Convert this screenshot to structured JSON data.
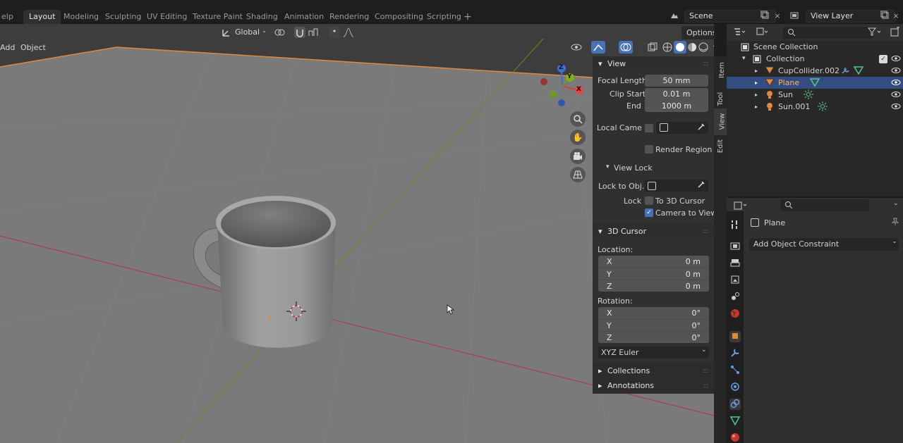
{
  "topbar": {
    "menu_fragment": "elp",
    "tabs": [
      "Layout",
      "Modeling",
      "Sculpting",
      "UV Editing",
      "Texture Paint",
      "Shading",
      "Animation",
      "Rendering",
      "Compositing",
      "Scripting"
    ],
    "active_tab": "Layout",
    "add_workspace": "+",
    "scene_name": "Scene",
    "view_layer": "View Layer"
  },
  "viewport_header": {
    "add": "Add",
    "object": "Object",
    "orientation": "Global",
    "options": "Options"
  },
  "gizmo": {
    "x": "X",
    "y": "Y",
    "z": "Z"
  },
  "sidebar_tabs": [
    "Item",
    "Tool",
    "View",
    "Edit"
  ],
  "sidebar_active_tab": "View",
  "view_panel": {
    "title": "View",
    "focal_length_label": "Focal Length",
    "focal_length_value": "50 mm",
    "clip_start_label": "Clip Start",
    "clip_start_value": "0.01 m",
    "end_label": "End",
    "end_value": "1000 m",
    "local_camera_label": "Local Came",
    "render_region_label": "Render Region",
    "view_lock_title": "View Lock",
    "lock_to_object_label": "Lock to Obj...",
    "lock_label": "Lock",
    "to_3d_cursor_label": "To 3D Cursor",
    "camera_to_view_label": "Camera to View"
  },
  "cursor_panel": {
    "title": "3D Cursor",
    "location_label": "Location:",
    "location": [
      {
        "axis": "X",
        "value": "0 m"
      },
      {
        "axis": "Y",
        "value": "0 m"
      },
      {
        "axis": "Z",
        "value": "0 m"
      }
    ],
    "rotation_label": "Rotation:",
    "rotation": [
      {
        "axis": "X",
        "value": "0°"
      },
      {
        "axis": "Y",
        "value": "0°"
      },
      {
        "axis": "Z",
        "value": "0°"
      }
    ],
    "rotation_mode": "XYZ Euler"
  },
  "collapsed_panels": [
    "Collections",
    "Annotations"
  ],
  "outliner": {
    "root": "Scene Collection",
    "collection": "Collection",
    "items": [
      {
        "name": "CupCollider.002",
        "selected": false
      },
      {
        "name": "Plane",
        "selected": true
      },
      {
        "name": "Sun",
        "selected": false
      },
      {
        "name": "Sun.001",
        "selected": false
      }
    ]
  },
  "properties": {
    "object_name": "Plane",
    "add_constraint": "Add Object Constraint"
  },
  "colors": {
    "selection_blue": "#334d80",
    "viewport_grey": "#3d3d3d",
    "panel_grey": "#303030",
    "axis_red": "#b0343c",
    "axis_green": "#6a8a25",
    "accent_orange": "#e08a3c"
  }
}
